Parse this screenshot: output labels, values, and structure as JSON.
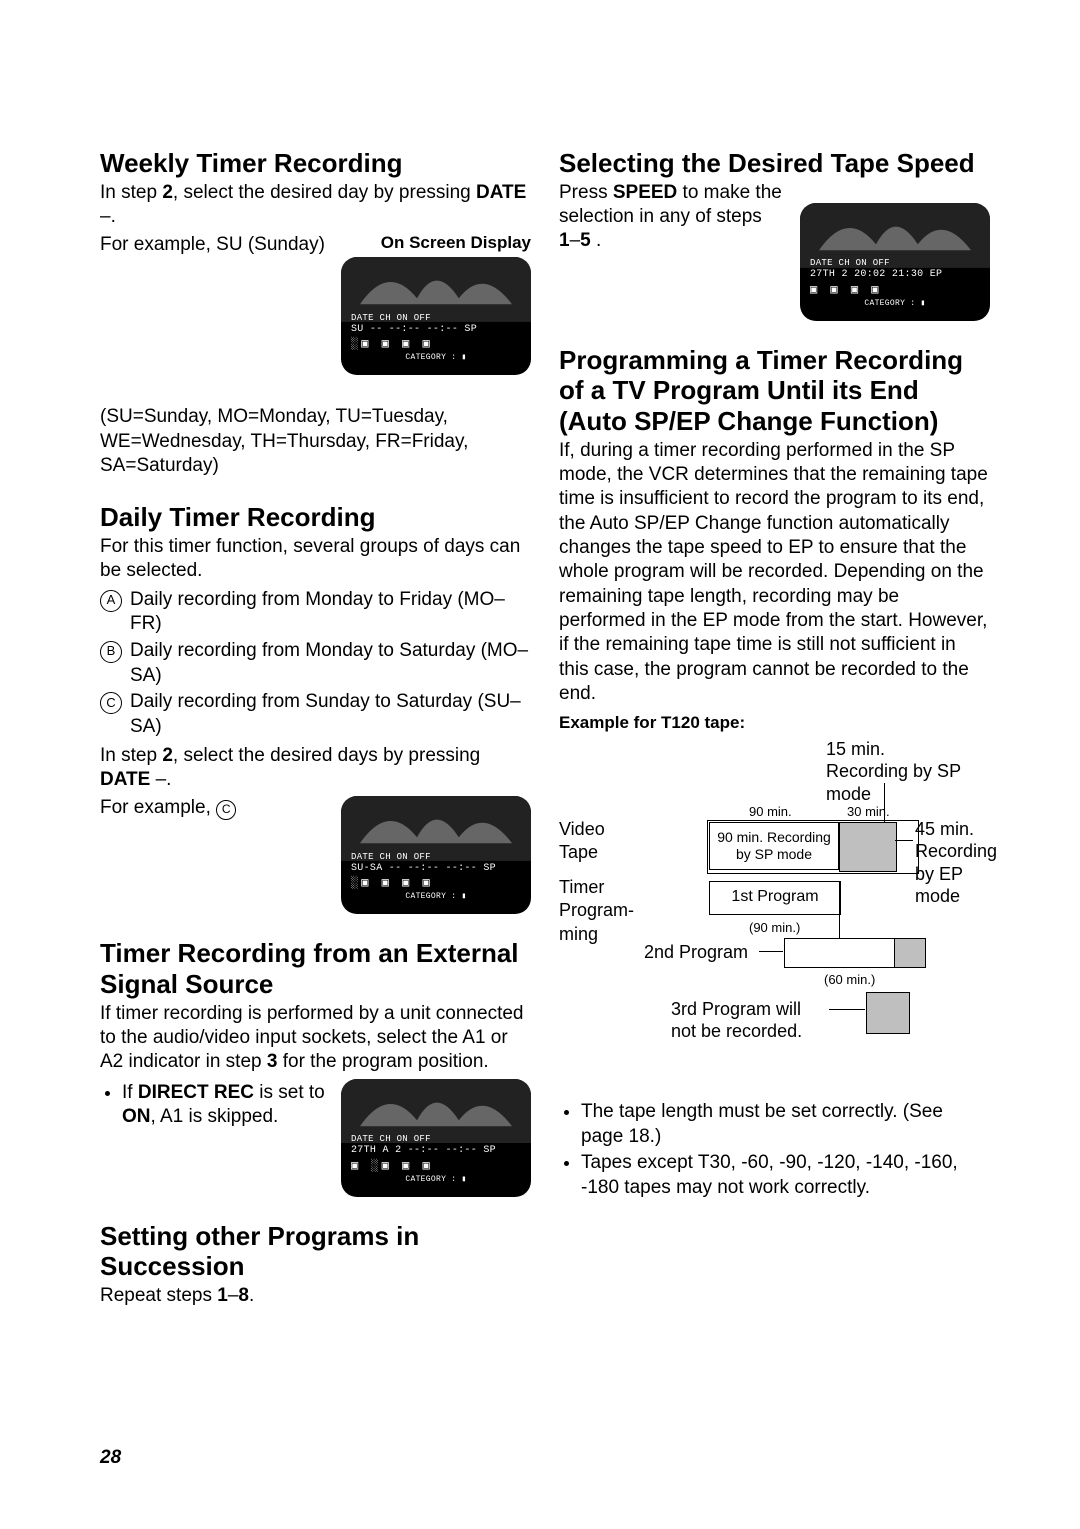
{
  "left": {
    "weekly": {
      "heading": "Weekly Timer Recording",
      "p1_a": "In step ",
      "p1_b": "2",
      "p1_c": ", select the desired day by pressing ",
      "p1_d": "DATE",
      "p1_e": " –.",
      "osd_label": "On Screen Display",
      "example": "For example, SU (Sunday)",
      "osd": {
        "head": "DATE  CH ON     OFF",
        "line": "SU    -- --:-- --:-- SP",
        "cat": "CATEGORY : ▮"
      },
      "days": "(SU=Sunday, MO=Monday, TU=Tuesday, WE=Wednesday, TH=Thursday, FR=Friday, SA=Saturday)"
    },
    "daily": {
      "heading": "Daily Timer Recording",
      "p1": "For this timer function, several groups of days can be selected.",
      "items": [
        {
          "letter": "A",
          "text": "Daily recording from Monday to Friday (MO–FR)"
        },
        {
          "letter": "B",
          "text": "Daily recording from Monday to Saturday (MO–SA)"
        },
        {
          "letter": "C",
          "text": "Daily recording from Sunday to Saturday (SU–SA)"
        }
      ],
      "p2_a": "In step ",
      "p2_b": "2",
      "p2_c": ", select the desired days by pressing ",
      "p2_d": "DATE",
      "p2_e": " –.",
      "example_a": "For example, ",
      "example_b": "C",
      "osd": {
        "head": "DATE   CH ON     OFF",
        "line": "SU-SA -- --:-- --:-- SP",
        "cat": "CATEGORY : ▮"
      }
    },
    "external": {
      "heading": "Timer Recording from an External Signal Source",
      "p1": "If timer recording is performed by a unit connected to the audio/video input sockets, select the A1 or A2 indicator in step ",
      "p1_b": "3",
      "p1_c": " for the program position.",
      "bullet_a": "If ",
      "bullet_b": "DIRECT REC",
      "bullet_c": " is set to ",
      "bullet_d": "ON",
      "bullet_e": ", A1 is skipped.",
      "osd": {
        "head": "DATE  CH ON     OFF",
        "line": "27TH A 2 --:-- --:-- SP",
        "cat": "CATEGORY : ▮"
      }
    },
    "succession": {
      "heading": "Setting other Programs in Succession",
      "p1_a": "Repeat steps ",
      "p1_b": "1",
      "p1_c": "–",
      "p1_d": "8",
      "p1_e": "."
    }
  },
  "right": {
    "speed": {
      "heading": "Selecting the Desired Tape Speed",
      "p1_a": "Press ",
      "p1_b": "SPEED",
      "p1_c": " to make the selection in any of steps ",
      "p1_d": "1",
      "p1_e": "–",
      "p1_f": "5",
      "p1_g": " .",
      "osd": {
        "head": "DATE  CH ON     OFF",
        "line": "27TH  2 20:02 21:30 EP",
        "cat": "CATEGORY : ▮"
      }
    },
    "auto": {
      "heading": "Programming a Timer Recording of a TV Program Until its End\n(Auto SP/EP Change Function)",
      "heading_l1": "Programming a Timer Recording of a TV Program Until its End",
      "heading_l2": "(Auto SP/EP Change Function)",
      "p1": "If, during a timer recording performed in the SP mode, the VCR determines that the remaining tape time is insufficient to record the program to its end, the Auto SP/EP Change function automatically changes the tape speed to EP to ensure that the whole program will be recorded. Depending on the remaining tape length, recording may be performed in the EP mode from the start. However, if the remaining tape time is still not sufficient in this case, the program cannot be recorded to the end.",
      "example_label": "Example for T120 tape:",
      "diagram": {
        "top_15": "15 min. Recording by SP mode",
        "m90": "90 min.",
        "m30": "30 min.",
        "video": "Video Tape",
        "box90": "90 min. Recording by SP mode",
        "r45": "45 min. Recording by EP mode",
        "timer": "Timer Program-ming",
        "first": "1st Program",
        "m90b": "(90 min.)",
        "second": "2nd Program",
        "m60": "(60 min.)",
        "third": "3rd Program will not be recorded."
      },
      "bullets": [
        "The tape length must be set correctly. (See page 18.)",
        "Tapes except T30, -60, -90, -120, -140, -160, -180 tapes may not work correctly."
      ]
    }
  },
  "page_number": "28"
}
